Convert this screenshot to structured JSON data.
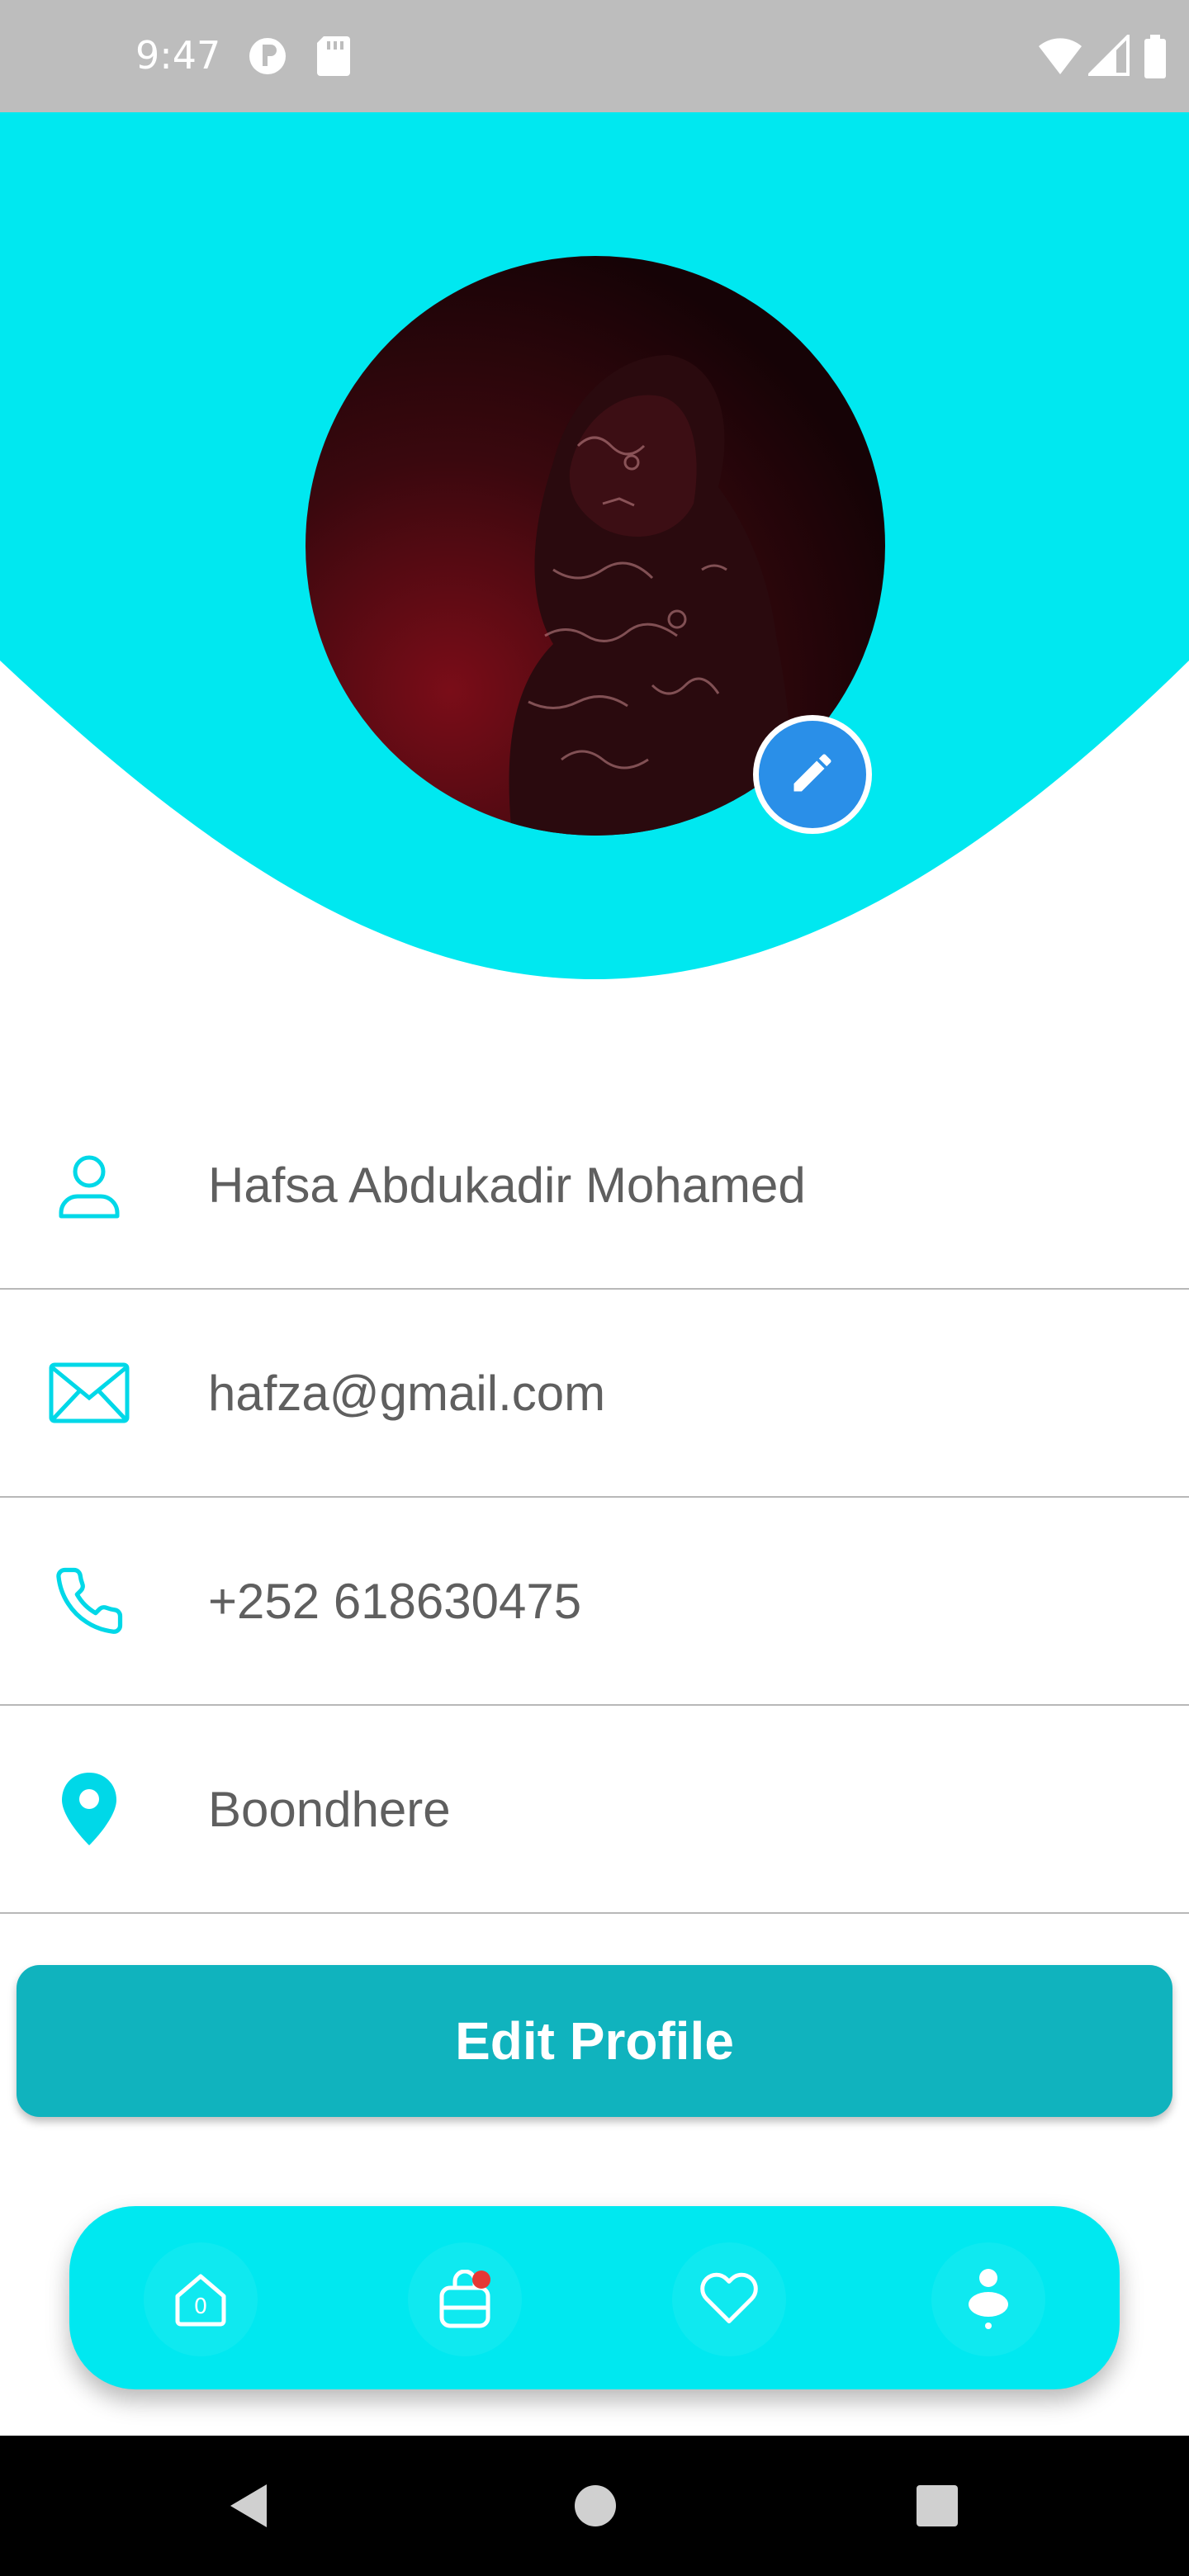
{
  "status_bar": {
    "time": "9:47",
    "icons": [
      "privacy-indicator-icon",
      "sd-card-icon",
      "wifi-icon",
      "cellular-signal-icon",
      "battery-icon"
    ]
  },
  "colors": {
    "accent_cyan": "#00E8F0",
    "button_teal": "#10B3BE",
    "edit_blue": "#2A8FE8",
    "text_gray": "#5F5F5F"
  },
  "profile": {
    "avatar": "profile-photo",
    "edit_avatar_icon": "pencil-icon"
  },
  "info_rows": [
    {
      "icon": "user-icon",
      "value": "Hafsa Abdukadir Mohamed"
    },
    {
      "icon": "mail-icon",
      "value": "hafza@gmail.com"
    },
    {
      "icon": "phone-icon",
      "value": "+252 618630475"
    },
    {
      "icon": "location-pin-icon",
      "value": "Boondhere"
    }
  ],
  "actions": {
    "edit_profile_label": "Edit Profile"
  },
  "bottom_nav": {
    "items": [
      {
        "icon": "home-icon",
        "badge": "0"
      },
      {
        "icon": "shopping-bag-icon",
        "badge_dot": true
      },
      {
        "icon": "heart-icon"
      },
      {
        "icon": "profile-icon",
        "active": true
      }
    ]
  },
  "system_nav": [
    "back-icon",
    "home-circle-icon",
    "recents-icon"
  ]
}
